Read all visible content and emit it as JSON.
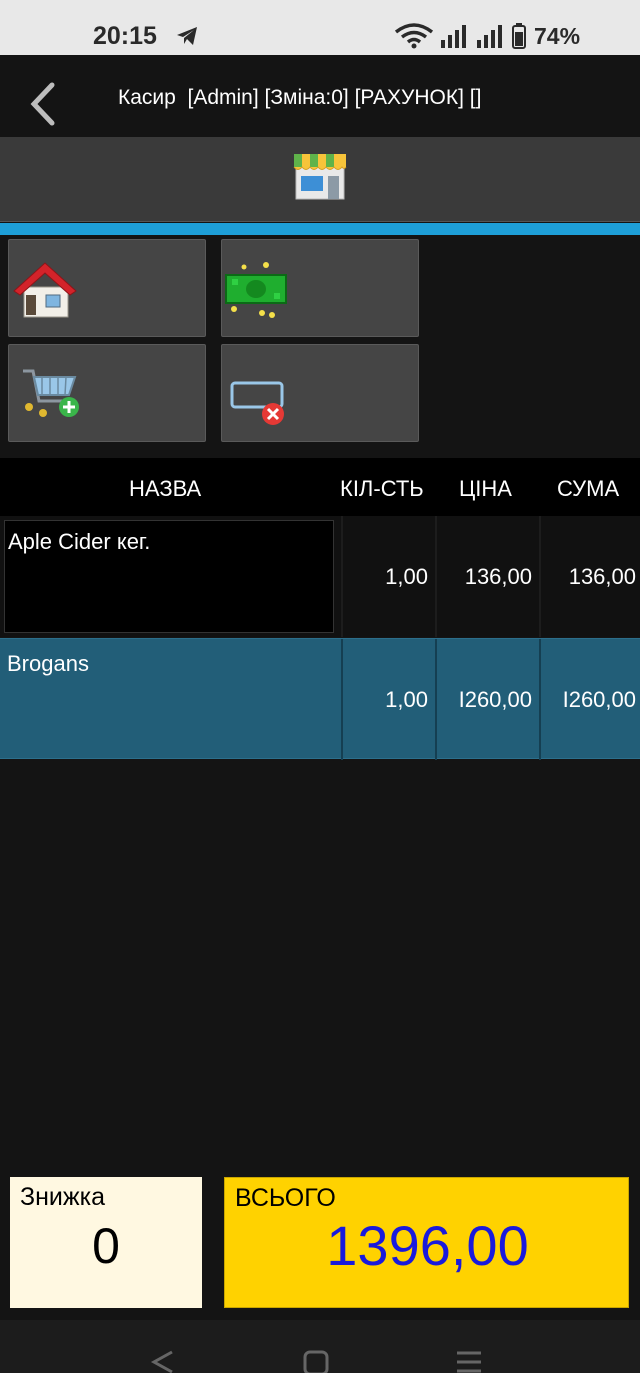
{
  "status_bar": {
    "time": "20:15",
    "battery": "74%",
    "icons": [
      "telegram-icon",
      "wifi-icon",
      "signal-icon",
      "signal-icon",
      "battery-icon"
    ]
  },
  "header": {
    "title": "Касир  [Admin] [Зміна:0] [РАХУНОК] []",
    "back_icon": "chevron-left-icon"
  },
  "store_bar": {
    "icon": "store-icon"
  },
  "toolbar": {
    "buttons": [
      {
        "icon": "home-icon"
      },
      {
        "icon": "money-icon"
      },
      {
        "icon": "cart-add-icon"
      },
      {
        "icon": "clear-field-icon"
      }
    ]
  },
  "table": {
    "columns": [
      "НАЗВА",
      "КІЛ-СТЬ",
      "ЦІНА",
      "СУМА"
    ],
    "rows": [
      {
        "name": "Aple Cider кег.",
        "qty": "1,00",
        "price": "136,00",
        "sum": "136,00"
      },
      {
        "name": "Brogans",
        "qty": "1,00",
        "price": "I260,00",
        "sum": "I260,00"
      }
    ]
  },
  "summary": {
    "discount_label": "Знижка",
    "discount_value": "0",
    "total_label": "ВСЬОГО",
    "total_value": "1396,00"
  },
  "colors": {
    "accent": "#1e9fd8",
    "selected_row": "#225e78",
    "total_bg": "#ffd200",
    "total_text": "#1a1adc",
    "discount_bg": "#fff8e1"
  },
  "nav_bar": {
    "icons": [
      "back-icon",
      "home-icon",
      "recents-icon"
    ]
  }
}
